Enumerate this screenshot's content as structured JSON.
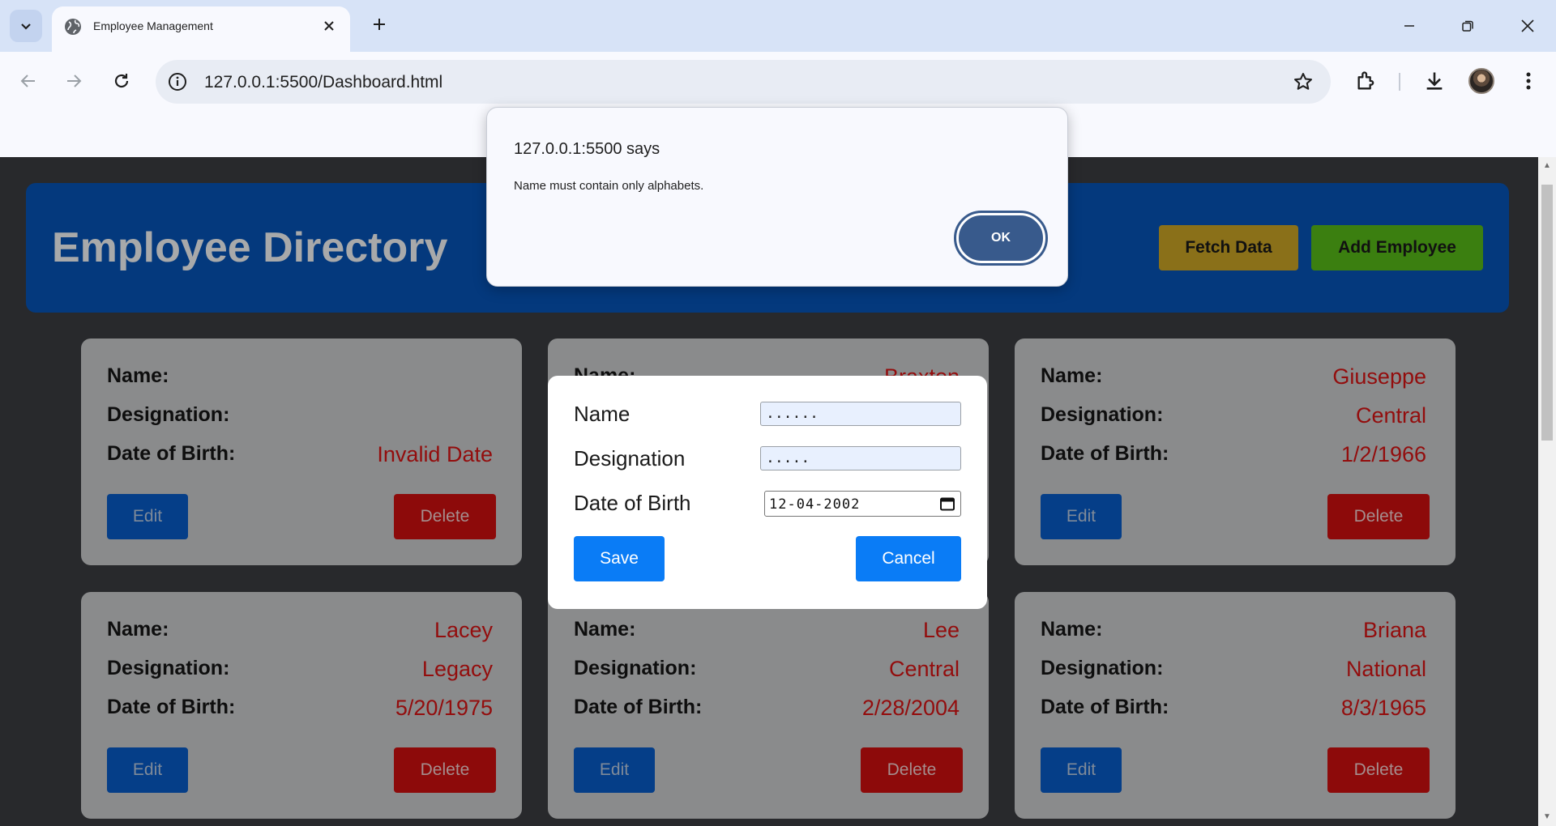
{
  "browser": {
    "tab_title": "Employee Management",
    "url": "127.0.0.1:5500/Dashboard.html"
  },
  "header": {
    "title": "Employee Directory",
    "fetch_label": "Fetch Data",
    "add_label": "Add Employee"
  },
  "labels": {
    "name": "Name:",
    "designation": "Designation:",
    "dob": "Date of Birth:",
    "edit": "Edit",
    "delete": "Delete"
  },
  "cards": [
    {
      "name": "",
      "designation": "",
      "dob": "Invalid Date"
    },
    {
      "name": "Braxton",
      "designation": "",
      "dob": ""
    },
    {
      "name": "Giuseppe",
      "designation": "Central",
      "dob": "1/2/1966"
    },
    {
      "name": "Lacey",
      "designation": "Legacy",
      "dob": "5/20/1975"
    },
    {
      "name": "Lee",
      "designation": "Central",
      "dob": "2/28/2004"
    },
    {
      "name": "Briana",
      "designation": "National",
      "dob": "8/3/1965"
    }
  ],
  "modal": {
    "name_label": "Name",
    "designation_label": "Designation",
    "dob_label": "Date of Birth",
    "name_value": "......",
    "designation_value": ".....",
    "dob_value": "12-04-2002",
    "save_label": "Save",
    "cancel_label": "Cancel"
  },
  "alert": {
    "title": "127.0.0.1:5500 says",
    "message": "Name must contain only alphabets.",
    "ok_label": "OK"
  },
  "colors": {
    "header_bg": "#04397d",
    "fetch_btn": "#8a7019",
    "add_btn": "#3b7f10",
    "card_value": "#930d0d",
    "primary_btn": "#0a7cf6"
  }
}
